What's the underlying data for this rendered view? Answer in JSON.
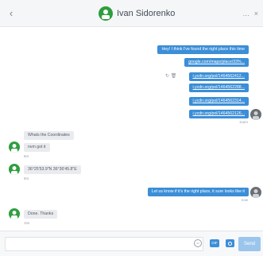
{
  "header": {
    "back_icon": "chevron-left-icon",
    "contact_name": "Ivan Sidorenko",
    "more_label": "…",
    "close_label": "×"
  },
  "messages": [
    {
      "direction": "out",
      "text": "Hey! I think I've found the right place this time",
      "time": ""
    },
    {
      "direction": "out",
      "text": "google.com/maps/place/33%...",
      "link": true,
      "time": ""
    },
    {
      "direction": "out",
      "text": "i.ycdn.org/pol/1464562412...",
      "link": true,
      "time": ""
    },
    {
      "direction": "out",
      "text": "i.ycdn.org/pol/1464562288...",
      "link": true,
      "time": ""
    },
    {
      "direction": "out",
      "text": "i.ycdn.org/pol/1464562314...",
      "link": true,
      "time": ""
    },
    {
      "direction": "out",
      "text": "i.ycdn.org/pol/1464562126...",
      "link": true,
      "time": "11am"
    },
    {
      "direction": "in",
      "text": "Whats the Coordinates",
      "time": ""
    },
    {
      "direction": "in",
      "text": "nvm got it",
      "time": "8m"
    },
    {
      "direction": "in",
      "text": "36°25'53.9\"N 36°36'45.8\"E",
      "time": "8m"
    },
    {
      "direction": "out",
      "text": "Let us know if it's the right place, it sure looks like it",
      "time": "now"
    },
    {
      "direction": "in",
      "text": "Done. Thanks",
      "time": "10s"
    }
  ],
  "composer": {
    "placeholder": "",
    "gif_label": "GIF",
    "send_label": "Send"
  },
  "colors": {
    "accent": "#3b8ed7",
    "contact_avatar": "#2e9e3f"
  }
}
